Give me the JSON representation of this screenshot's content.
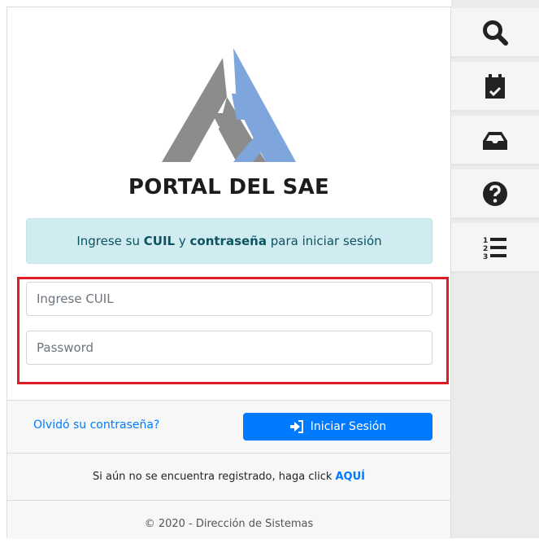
{
  "portal": {
    "title": "PORTAL DEL SAE",
    "info": {
      "prefix": "Ingrese su ",
      "cuil": "CUIL",
      "middle": " y ",
      "password": "contraseña",
      "suffix": " para iniciar sesión"
    },
    "cuil_placeholder": "Ingrese CUIL",
    "password_placeholder": "Password",
    "forgot_label": "Olvidó su contraseña?",
    "login_label": "Iniciar Sesión",
    "register_text": "Si aún no se encuentra registrado, haga click ",
    "register_link": "AQUÍ",
    "copyright": "© 2020 - Dirección de Sistemas"
  },
  "sidebar": {
    "items": [
      {
        "icon": "search-icon"
      },
      {
        "icon": "calendar-check-icon"
      },
      {
        "icon": "inbox-icon"
      },
      {
        "icon": "question-circle-icon"
      },
      {
        "icon": "ordered-list-icon"
      }
    ]
  },
  "colors": {
    "primary": "#007bff",
    "info_bg": "#d1ecf1",
    "info_text": "#0c5460",
    "highlight": "#e01b24",
    "logo_gray": "#8c8c8c",
    "logo_blue": "#7fa6dc"
  }
}
